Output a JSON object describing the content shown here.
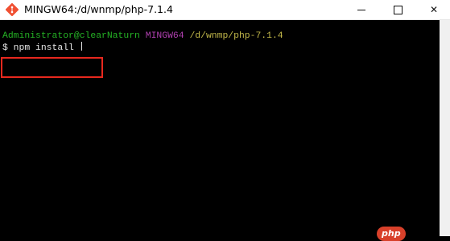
{
  "window": {
    "title": "MINGW64:/d/wnmp/php-7.1.4",
    "icon": "git-bash-icon",
    "controls": {
      "minimize_icon": "minimize-icon",
      "maximize_icon": "maximize-icon",
      "close_glyph": "✕"
    }
  },
  "terminal": {
    "prompt": {
      "user_host": "Administrator@clearNaturn",
      "system": "MINGW64",
      "cwd": "/d/wnmp/php-7.1.4"
    },
    "command_line": "$ npm install "
  },
  "colors": {
    "background": "#000000",
    "user_host": "#25b325",
    "system": "#b040b0",
    "cwd": "#c2b84a",
    "highlight_box": "#e8281e"
  },
  "watermark": {
    "text": "php"
  }
}
